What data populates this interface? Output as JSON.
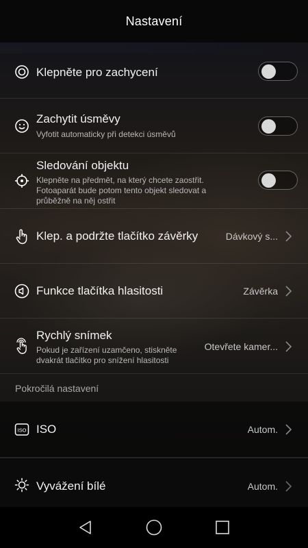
{
  "header": {
    "title": "Nastavení"
  },
  "rows": {
    "tap_capture": {
      "title": "Klepněte pro zachycení",
      "toggle": "off"
    },
    "smile": {
      "title": "Zachytit úsměvy",
      "subtitle": "Vyfotit automaticky při detekci úsměvů",
      "toggle": "off"
    },
    "tracking": {
      "title": "Sledování objektu",
      "subtitle_line1": "Klepněte na předmět, na který chcete zaostřit.",
      "subtitle_line2": "Fotoaparát bude potom tento objekt sledovat a",
      "subtitle_line3": "průběžně na něj ostřit",
      "toggle": "off"
    },
    "shutter_hold": {
      "title": "Klep. a podržte tlačítko závěrky",
      "value": "Dávkový s..."
    },
    "volume": {
      "title": "Funkce tlačítka hlasitosti",
      "value": "Závěrka"
    },
    "quick_snap": {
      "title": "Rychlý snímek",
      "subtitle_line1": "Pokud je zařízení uzamčeno, stiskněte",
      "subtitle_line2": "dvakrát tlačítko pro snížení hlasitosti",
      "value": "Otevřete kamer..."
    },
    "section_advanced": "Pokročilá nastavení",
    "iso": {
      "title": "ISO",
      "value": "Autom.",
      "icon_text": "ISO"
    },
    "white_balance": {
      "title": "Vyvážení bílé",
      "value": "Autom."
    }
  },
  "navbar": {
    "back": "back-icon",
    "home": "home-icon",
    "recents": "recents-icon"
  }
}
